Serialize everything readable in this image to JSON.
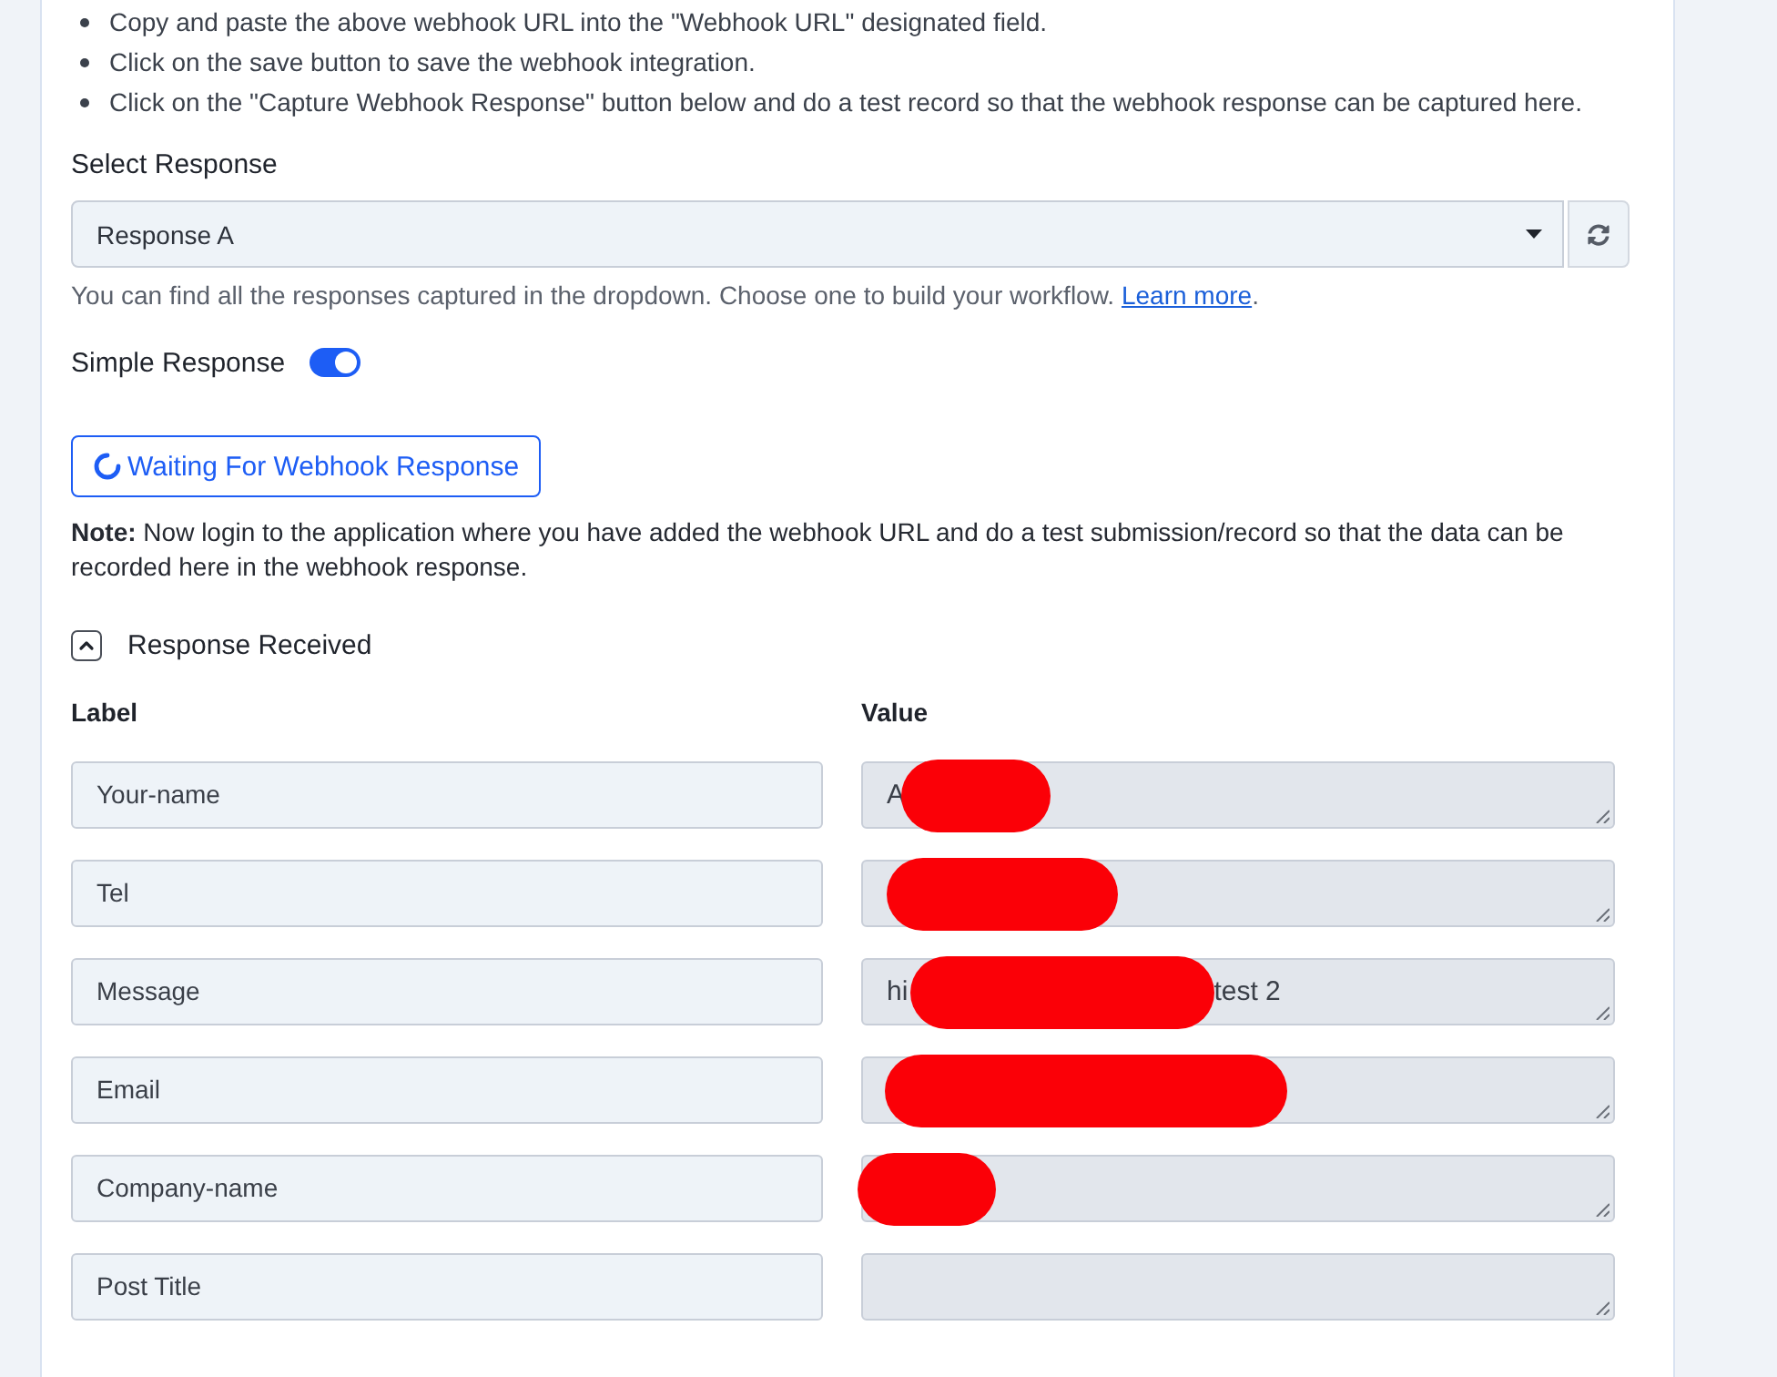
{
  "instructions": [
    "Copy and paste the above webhook URL into the \"Webhook URL\" designated field.",
    "Click on the save button to save the webhook integration.",
    "Click on the \"Capture Webhook Response\" button below and do a test record so that the webhook response can be captured here."
  ],
  "select_response": {
    "label": "Select Response",
    "value": "Response A",
    "help": "You can find all the responses captured in the dropdown. Choose one to build your workflow.",
    "link": "Learn more",
    "help_end": "."
  },
  "simple_response": {
    "label": "Simple Response",
    "on": true
  },
  "capture_button": {
    "label": "Waiting For Webhook Response",
    "waiting": true
  },
  "note": "**Note:** Now login to the application where you have added the webhook URL and do a test submission/record so that the data can be recorded here in the webhook response.",
  "response_received": {
    "title": "Response Received",
    "expanded": true,
    "columns": [
      "Label",
      "Value"
    ],
    "rows": [
      {
        "label": "Your-name",
        "value": {
          "disabled": true,
          "parts": [
            {
              "kind": "text",
              "text": "A"
            },
            {
              "kind": "redaction"
            }
          ]
        }
      },
      {
        "label": "Tel",
        "value": {
          "disabled": true,
          "parts": [
            {
              "kind": "redaction"
            }
          ]
        }
      },
      {
        "label": "Message",
        "value": {
          "disabled": true,
          "parts": [
            {
              "kind": "text",
              "text": "hi"
            },
            {
              "kind": "redaction"
            },
            {
              "kind": "text",
              "text": "test 2"
            }
          ]
        }
      },
      {
        "label": "Email",
        "value": {
          "disabled": true,
          "parts": [
            {
              "kind": "redaction"
            }
          ]
        }
      },
      {
        "label": "Company-name",
        "value": {
          "disabled": true,
          "parts": [
            {
              "kind": "redaction"
            }
          ]
        }
      },
      {
        "label": "Post Title",
        "value": {
          "disabled": true
        }
      }
    ]
  }
}
